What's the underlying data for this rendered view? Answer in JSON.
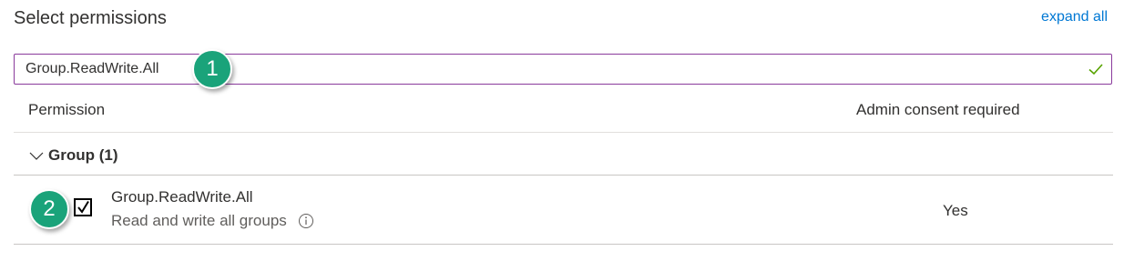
{
  "header": {
    "title": "Select permissions",
    "expand_all_label": "expand all"
  },
  "search": {
    "value": "Group.ReadWrite.All",
    "valid_icon": "checkmark-icon",
    "border_color": "#8a3a9c",
    "check_color": "#57a300"
  },
  "callouts": {
    "step1": "1",
    "step2": "2",
    "color": "#1aa37a"
  },
  "table": {
    "columns": {
      "permission": "Permission",
      "admin_consent": "Admin consent required"
    },
    "groups": [
      {
        "label": "Group (1)",
        "expanded": true,
        "permissions": [
          {
            "name": "Group.ReadWrite.All",
            "description": "Read and write all groups",
            "admin_consent": "Yes",
            "checked": true
          }
        ]
      }
    ]
  }
}
